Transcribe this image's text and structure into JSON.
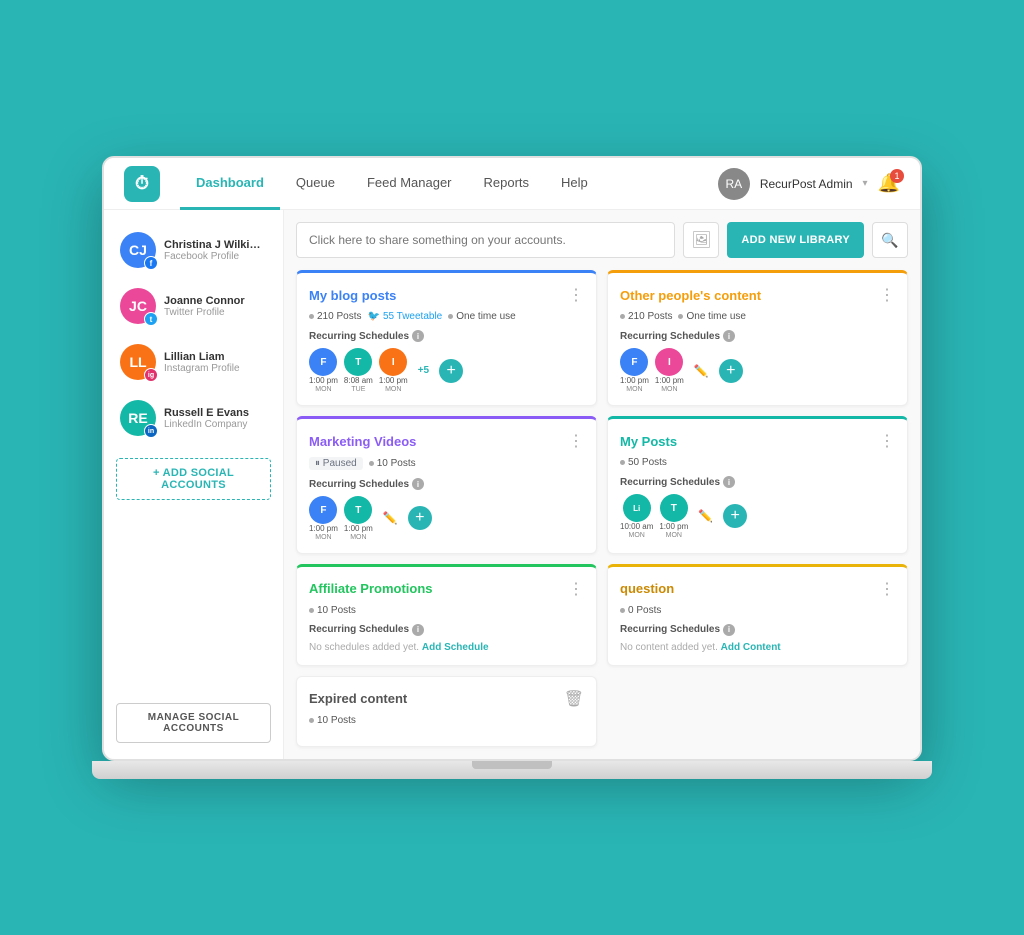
{
  "nav": {
    "logo_text": "⏱",
    "links": [
      {
        "id": "dashboard",
        "label": "Dashboard",
        "active": true
      },
      {
        "id": "queue",
        "label": "Queue",
        "active": false
      },
      {
        "id": "feed-manager",
        "label": "Feed Manager",
        "active": false
      },
      {
        "id": "reports",
        "label": "Reports",
        "active": false
      },
      {
        "id": "help",
        "label": "Help",
        "active": false
      }
    ],
    "user_name": "RecurPost Admin",
    "notification_count": "1"
  },
  "sidebar": {
    "accounts": [
      {
        "id": "1",
        "name": "Christina J Wilkinson",
        "type": "Facebook Profile",
        "initials": "CJ",
        "color": "av-blue",
        "badge": "fb-badge",
        "badge_text": "f"
      },
      {
        "id": "2",
        "name": "Joanne Connor",
        "type": "Twitter Profile",
        "initials": "JC",
        "color": "av-pink",
        "badge": "tw-badge",
        "badge_text": "t"
      },
      {
        "id": "3",
        "name": "Lillian Liam",
        "type": "Instagram Profile",
        "initials": "LL",
        "color": "av-orange",
        "badge": "ig-badge",
        "badge_text": "i"
      },
      {
        "id": "4",
        "name": "Russell E Evans",
        "type": "LinkedIn Company",
        "initials": "RE",
        "color": "av-teal",
        "badge": "li-badge",
        "badge_text": "in"
      }
    ],
    "add_account_label": "+ ADD SOCIAL ACCOUNTS",
    "manage_label": "MANAGE SOCIAL ACCOUNTS"
  },
  "topbar": {
    "share_placeholder": "Click here to share something on your accounts.",
    "add_library_label": "ADD NEW LIBRARY"
  },
  "libraries": [
    {
      "id": "my-blog-posts",
      "title": "My blog posts",
      "title_color": "blue",
      "border_color": "blue",
      "meta": [
        {
          "text": "210 Posts"
        },
        {
          "icon": "twitter",
          "text": "55 Tweetable"
        },
        {
          "text": "One time use"
        }
      ],
      "recurring_schedules": true,
      "schedules": [
        {
          "time": "1:00 pm",
          "day": "MON",
          "color": "av-blue",
          "initials": "F"
        },
        {
          "time": "8:08 am",
          "day": "TUE",
          "color": "av-teal",
          "initials": "T"
        },
        {
          "time": "1:00 pm",
          "day": "MON",
          "color": "av-orange",
          "initials": "I"
        }
      ],
      "extra_schedules": "+5",
      "show_add": true
    },
    {
      "id": "other-peoples-content",
      "title": "Other people's content",
      "title_color": "orange",
      "border_color": "orange",
      "meta": [
        {
          "text": "210 Posts"
        },
        {
          "text": "One time use"
        }
      ],
      "recurring_schedules": true,
      "schedules": [
        {
          "time": "1:00 pm",
          "day": "MON",
          "color": "av-blue",
          "initials": "F"
        },
        {
          "time": "1:00 pm",
          "day": "MON",
          "color": "av-pink",
          "initials": "I"
        }
      ],
      "extra_schedules": null,
      "show_add": true,
      "show_edit": true
    },
    {
      "id": "marketing-videos",
      "title": "Marketing Videos",
      "title_color": "purple",
      "border_color": "purple",
      "paused": true,
      "meta": [
        {
          "text": "10 Posts"
        }
      ],
      "recurring_schedules": true,
      "schedules": [
        {
          "time": "1:00 pm",
          "day": "MON",
          "color": "av-blue",
          "initials": "F"
        },
        {
          "time": "1:00 pm",
          "day": "MON",
          "color": "av-teal",
          "initials": "T"
        }
      ],
      "show_add": true,
      "show_edit": true
    },
    {
      "id": "my-posts",
      "title": "My Posts",
      "title_color": "teal",
      "border_color": "teal",
      "meta": [
        {
          "text": "50 Posts"
        }
      ],
      "recurring_schedules": true,
      "schedules": [
        {
          "time": "10:00 am",
          "day": "MON",
          "color": "av-teal",
          "initials": "Li"
        },
        {
          "time": "1:00 pm",
          "day": "MON",
          "color": "av-teal",
          "initials": "T"
        }
      ],
      "show_add": true,
      "show_edit": true
    },
    {
      "id": "affiliate-promotions",
      "title": "Affiliate Promotions",
      "title_color": "green",
      "border_color": "green",
      "meta": [
        {
          "text": "10 Posts"
        }
      ],
      "recurring_schedules": true,
      "no_schedule": true,
      "no_schedule_text": "No schedules added yet.",
      "add_schedule_link": "Add Schedule",
      "show_add": false
    },
    {
      "id": "question",
      "title": "question",
      "title_color": "yellow",
      "border_color": "yellow",
      "meta": [
        {
          "text": "0 Posts"
        }
      ],
      "recurring_schedules": true,
      "no_schedule": true,
      "no_schedule_text": "No content added yet.",
      "add_schedule_link": "Add Content",
      "show_add": false
    }
  ],
  "expired": {
    "title": "Expired content",
    "meta": "10 Posts"
  }
}
